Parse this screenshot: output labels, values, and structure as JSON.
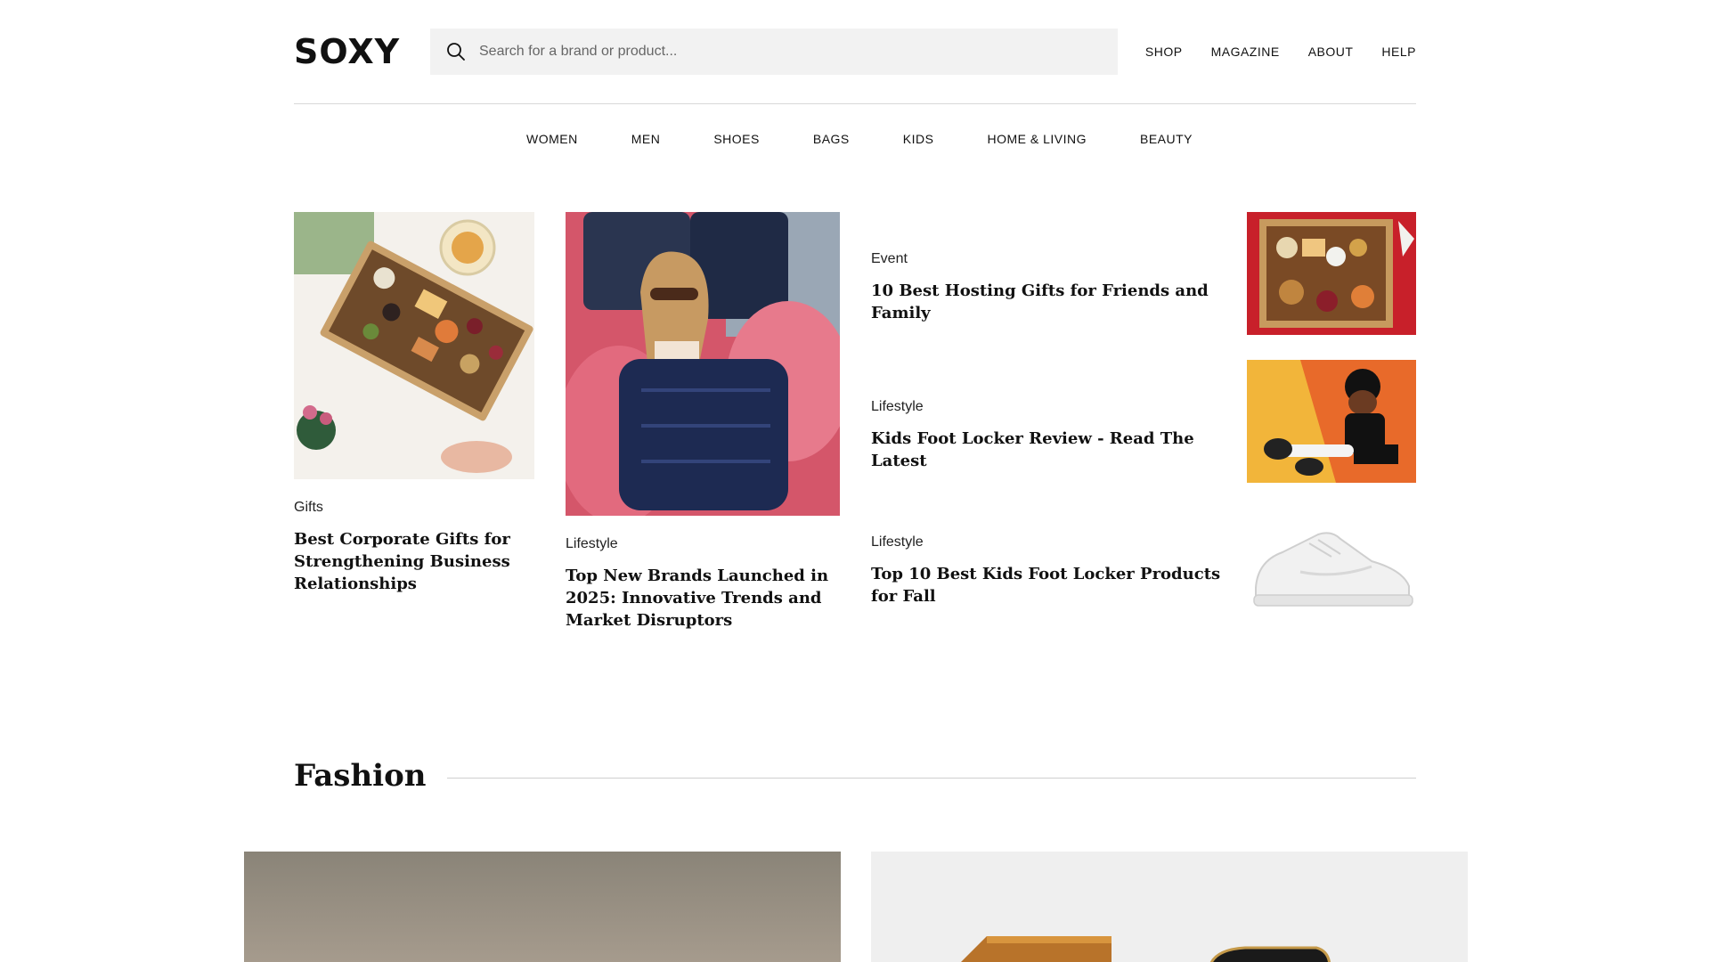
{
  "brand": {
    "logo": "SOXY"
  },
  "search": {
    "placeholder": "Search for a brand or product..."
  },
  "topnav": {
    "shop": "SHOP",
    "magazine": "MAGAZINE",
    "about": "ABOUT",
    "help": "HELP"
  },
  "categories": [
    "WOMEN",
    "MEN",
    "SHOES",
    "BAGS",
    "KIDS",
    "HOME & LIVING",
    "BEAUTY"
  ],
  "featured": {
    "card1": {
      "tag": "Gifts",
      "title": "Best Corporate Gifts for Strengthening Business Relationships"
    },
    "card2": {
      "tag": "Lifestyle",
      "title": "Top New Brands Launched in 2025: Innovative Trends and Market Disruptors"
    },
    "side": [
      {
        "tag": "Event",
        "title": "10 Best Hosting Gifts for Friends and Family"
      },
      {
        "tag": "Lifestyle",
        "title": "Kids Foot Locker Review - Read The Latest"
      },
      {
        "tag": "Lifestyle",
        "title": "Top 10 Best Kids Foot Locker Products for Fall"
      }
    ]
  },
  "fashion_section": {
    "title": "Fashion"
  },
  "colors": {
    "accent": "#111111",
    "search_bg": "#f2f2f2",
    "divider": "#d8d8d8"
  },
  "icons": {
    "search": "search-icon"
  }
}
